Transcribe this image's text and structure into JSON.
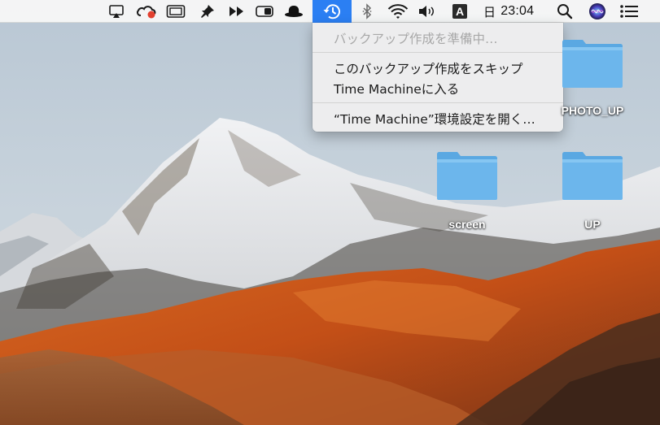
{
  "menubar": {
    "items": [
      {
        "name": "airplay-icon"
      },
      {
        "name": "creative-cloud-icon"
      },
      {
        "name": "display-mirroring-icon"
      },
      {
        "name": "pin-icon"
      },
      {
        "name": "fast-forward-icon"
      },
      {
        "name": "toggle-switch-icon"
      },
      {
        "name": "hat-icon"
      },
      {
        "name": "time-machine-icon"
      },
      {
        "name": "bluetooth-icon"
      },
      {
        "name": "wifi-icon"
      },
      {
        "name": "volume-icon"
      },
      {
        "name": "input-source-icon"
      },
      {
        "name": "spotlight-search-icon"
      },
      {
        "name": "siri-icon"
      },
      {
        "name": "notification-center-icon"
      }
    ],
    "input_source_letter": "A",
    "clock_day": "日",
    "clock_time": "23:04",
    "time_machine_active_color": "#2b7ff3"
  },
  "dropdown": {
    "status": "バックアップ作成を準備中…",
    "skip_line1": "このバックアップ作成をスキップ",
    "enter": "Time Machineに入る",
    "open_prefs": "“Time Machine”環境設定を開く…"
  },
  "desktop": {
    "folders": [
      {
        "label": "PHOTO_UP"
      },
      {
        "label": "screen"
      },
      {
        "label": "UP"
      }
    ],
    "folder_color": "#6cb6ec"
  }
}
